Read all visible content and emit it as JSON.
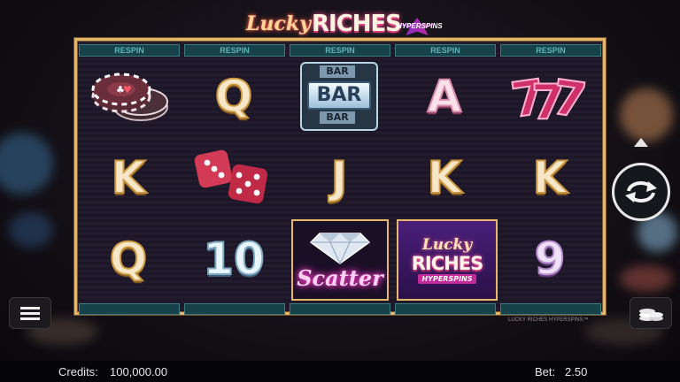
{
  "game": {
    "logo_script": "Lucky",
    "logo_main": "RICHES",
    "logo_badge": "HYPERSPINS",
    "footer_text": "LUCKY RICHES HYPERSPINS™"
  },
  "respin_labels": [
    "RESPIN",
    "RESPIN",
    "RESPIN",
    "RESPIN",
    "RESPIN"
  ],
  "reels": [
    [
      "poker-chips",
      "K",
      "Q"
    ],
    [
      "Q",
      "dice",
      "10"
    ],
    [
      "BAR",
      "J",
      "scatter"
    ],
    [
      "A",
      "K",
      "lucky-riches-wild"
    ],
    [
      "7",
      "K",
      "9"
    ]
  ],
  "symbols": {
    "q1": "Q",
    "k1": "K",
    "q2": "Q",
    "q3": "Q",
    "ten": "10",
    "bar_top": "BAR",
    "bar_mid": "BAR",
    "bar_bot": "BAR",
    "j": "J",
    "scatter_label": "Scatter",
    "a": "A",
    "k2": "K",
    "wild_script": "Lucky",
    "wild_main": "RICHES",
    "wild_badge": "HYPERSPINS",
    "k3": "K",
    "nine": "9"
  },
  "status": {
    "credits_label": "Credits:",
    "credits_value": "100,000.00",
    "bet_label": "Bet:",
    "bet_value": "2.50"
  },
  "colors": {
    "frame": "#e4b56a",
    "respin_bg": "#17424a",
    "scatter_glow": "#ff3cc8",
    "accent_pink": "#d0306a"
  }
}
